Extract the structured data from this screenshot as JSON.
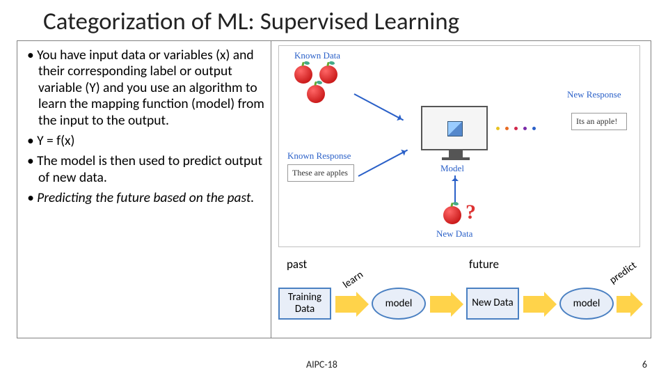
{
  "title": "Categorization of ML: Supervised Learning",
  "bullets": {
    "b1": "You have input data or variables (x) and their corresponding label or output variable (Y) and you use an algorithm to learn the mapping function (model) from the input to the output.",
    "b2": "Y = f(x)",
    "b3": "The model is then used to predict output of new data.",
    "b4": "Predicting the future based on the past."
  },
  "diagram": {
    "known_data": "Known Data",
    "known_response": "Known Response",
    "response_text": "These are apples",
    "model": "Model",
    "new_data": "New Data",
    "new_response": "New Response",
    "new_response_text": "Its an apple!"
  },
  "flow": {
    "past": "past",
    "future": "future",
    "learn": "learn",
    "predict": "predict",
    "training_data": "Training Data",
    "model": "model",
    "new_data": "New Data"
  },
  "footer": {
    "code": "AIPC-18",
    "page": "6"
  }
}
